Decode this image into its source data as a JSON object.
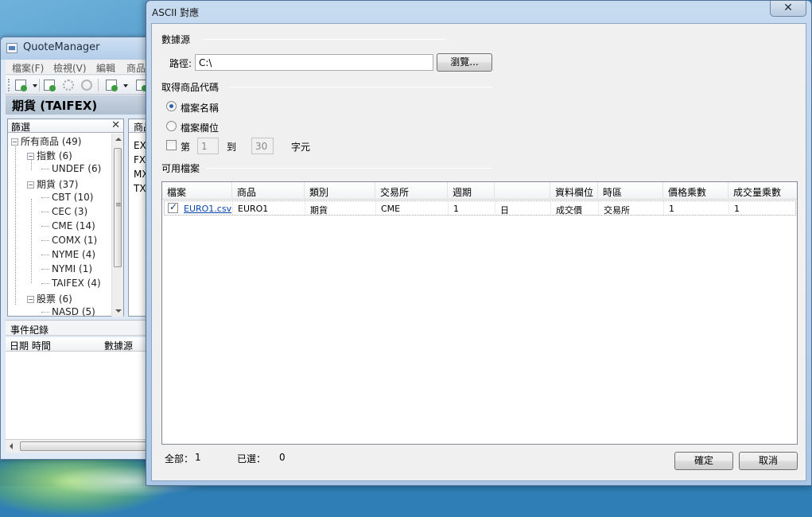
{
  "background_app": {
    "title": "QuoteManager",
    "menu": [
      "檔案(F)",
      "檢視(V)",
      "編輯",
      "商品"
    ],
    "heading": "期貨 (TAIFEX)",
    "filter": {
      "title": "篩選",
      "close": "✕",
      "tree": [
        {
          "toggle": "−",
          "label": "所有商品 (49)"
        },
        {
          "toggle": "−",
          "label": "指數 (6)"
        },
        {
          "toggle": "",
          "label": "UNDEF (6)"
        },
        {
          "toggle": "−",
          "label": "期貨 (37)"
        },
        {
          "toggle": "",
          "label": "CBT (10)"
        },
        {
          "toggle": "",
          "label": "CEC (3)"
        },
        {
          "toggle": "",
          "label": "CME (14)"
        },
        {
          "toggle": "",
          "label": "COMX (1)"
        },
        {
          "toggle": "",
          "label": "NYME (4)"
        },
        {
          "toggle": "",
          "label": "NYMI (1)"
        },
        {
          "toggle": "",
          "label": "TAIFEX (4)"
        },
        {
          "toggle": "−",
          "label": "股票 (6)"
        },
        {
          "toggle": "",
          "label": "NASD (5)"
        }
      ]
    },
    "codes": {
      "header": "商品",
      "items": [
        "EX",
        "FX",
        "MX",
        "TX"
      ]
    },
    "events": {
      "title": "事件紀錄",
      "columns": [
        "日期 時間",
        "數據源"
      ]
    }
  },
  "dialog": {
    "title": "ASCII 對應",
    "close_glyph": "✕",
    "source_group": "數據源",
    "path_label": "路徑:",
    "path_value": "C:\\",
    "browse_button": "瀏覽...",
    "code_group": "取得商品代碼",
    "radio_filename": "檔案名稱",
    "radio_field": "檔案欄位",
    "range": {
      "prefix": "第",
      "from": "1",
      "to_label": "到",
      "to": "30",
      "suffix": "字元"
    },
    "files_group": "可用檔案",
    "grid": {
      "columns": [
        "檔案",
        "商品",
        "類別",
        "交易所",
        "週期",
        "",
        "資料欄位",
        "時區",
        "價格乘數",
        "成交量乘數"
      ],
      "rows": [
        {
          "checked": true,
          "file": "EURO1.csv",
          "symbol": "EURO1",
          "category": "期貨",
          "exchange": "CME",
          "period": "1",
          "period_unit": "日",
          "field": "成交價",
          "timezone": "交易所",
          "price_mult": "1",
          "volume_mult": "1"
        }
      ]
    },
    "footer": {
      "total_label": "全部：",
      "total_value": "1",
      "selected_label": "已選：",
      "selected_value": "0"
    },
    "ok_button": "確定",
    "cancel_button": "取消"
  }
}
